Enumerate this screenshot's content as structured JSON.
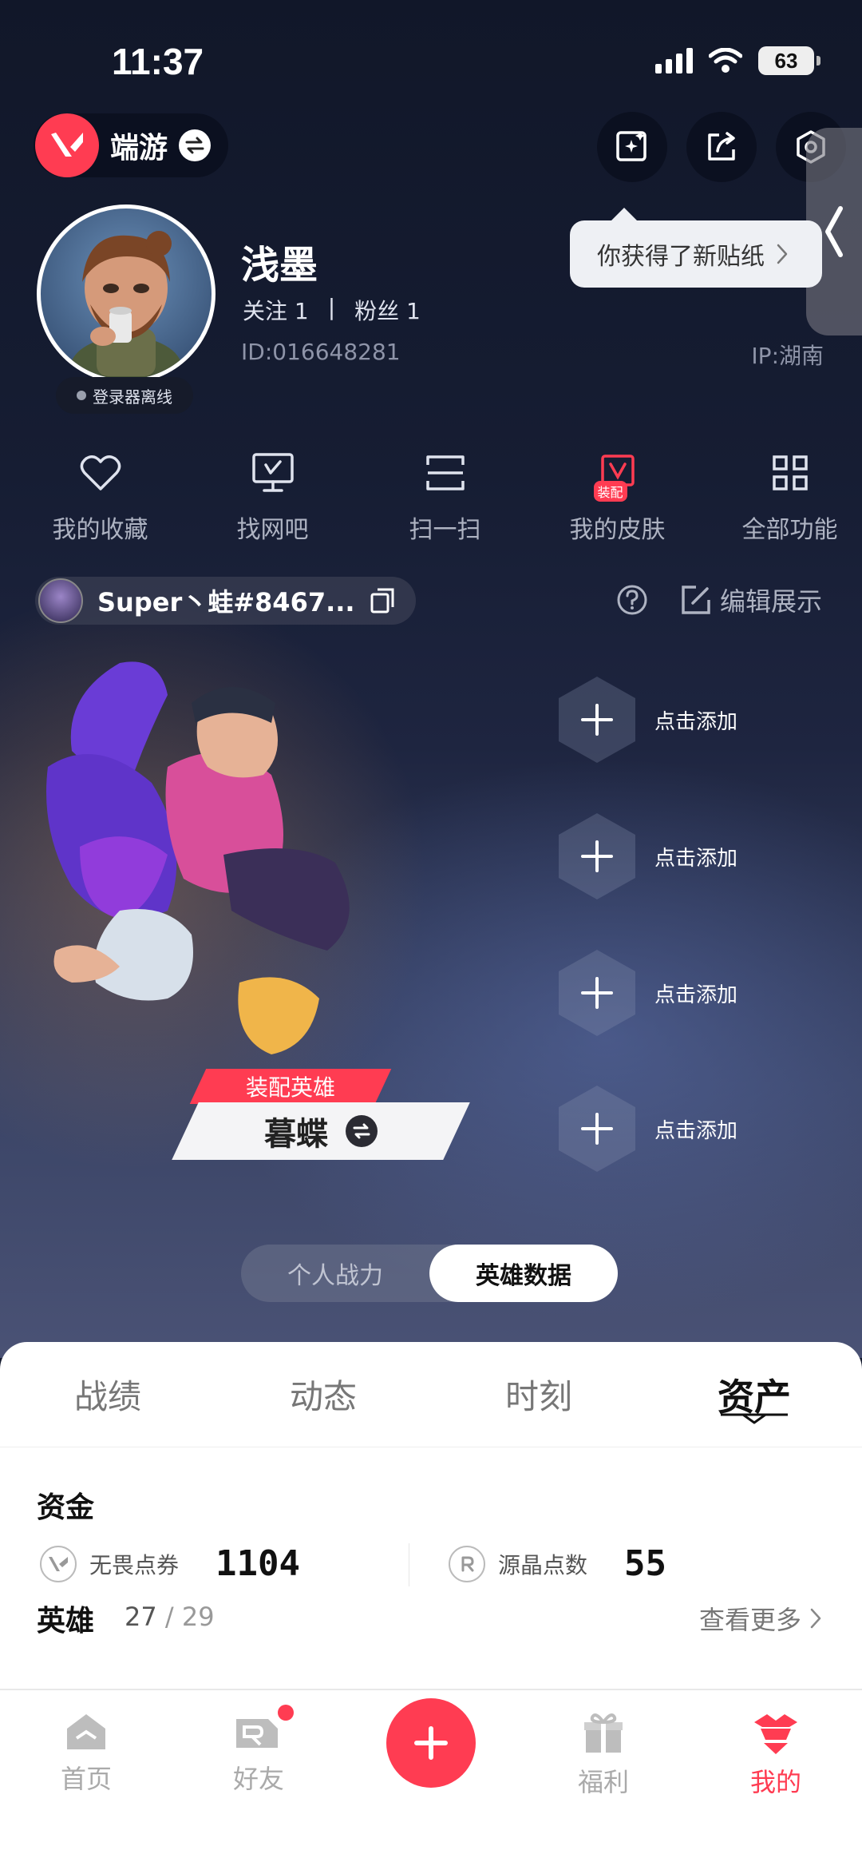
{
  "status_bar": {
    "time": "11:37",
    "battery": "63"
  },
  "brand": {
    "label": "端游"
  },
  "tooltip": {
    "text": "你获得了新贴纸"
  },
  "profile": {
    "name": "浅墨",
    "follow_label": "关注 1",
    "divider": "|",
    "fans_label": "粉丝 1",
    "id": "ID:016648281",
    "ip": "IP:湖南",
    "status": "登录器离线"
  },
  "quick_actions": [
    {
      "label": "我的收藏",
      "icon": "heart-icon"
    },
    {
      "label": "找网吧",
      "icon": "monitor-icon"
    },
    {
      "label": "扫一扫",
      "icon": "scan-icon"
    },
    {
      "label": "我的皮肤",
      "icon": "skin-icon",
      "badge": "装配"
    },
    {
      "label": "全部功能",
      "icon": "grid-icon"
    }
  ],
  "game_account": {
    "name": "Super丶蛙#8467..."
  },
  "edit_display": {
    "label": "编辑展示"
  },
  "hero": {
    "tag": "装配英雄",
    "name": "暮蝶"
  },
  "slots": [
    {
      "label": "点击添加"
    },
    {
      "label": "点击添加"
    },
    {
      "label": "点击添加"
    },
    {
      "label": "点击添加"
    }
  ],
  "switcher": {
    "left": "个人战力",
    "right": "英雄数据"
  },
  "tabs": [
    {
      "label": "战绩"
    },
    {
      "label": "动态"
    },
    {
      "label": "时刻"
    },
    {
      "label": "资产",
      "active": true
    }
  ],
  "assets": {
    "funds_title": "资金",
    "vp_label": "无畏点券",
    "vp_value": "1104",
    "rp_label": "源晶点数",
    "rp_value": "55",
    "heroes_title": "英雄",
    "heroes_owned": "27",
    "heroes_sep": "/",
    "heroes_total": "29",
    "more_label": "查看更多"
  },
  "nav": [
    {
      "label": "首页",
      "icon": "home-icon"
    },
    {
      "label": "好友",
      "icon": "friends-icon",
      "dot": true
    },
    {
      "label": "",
      "icon": "plus-icon"
    },
    {
      "label": "福利",
      "icon": "gift-icon"
    },
    {
      "label": "我的",
      "icon": "profile-icon",
      "active": true
    }
  ],
  "colors": {
    "accent": "#ff3c52",
    "sheet": "#ffffff",
    "background": "#141a2e"
  }
}
